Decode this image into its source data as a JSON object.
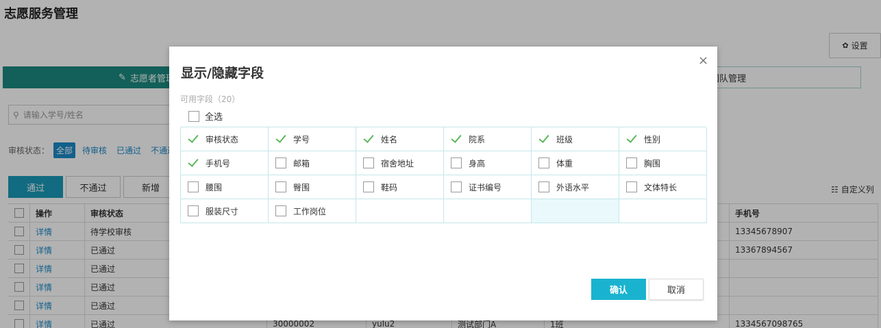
{
  "page": {
    "title": "志愿服务管理",
    "settings_label": "设置",
    "tabs": {
      "active": "志愿者管理",
      "inactive": "团队管理"
    },
    "search_placeholder": "请输入学号/姓名",
    "filter": {
      "label": "审核状态：",
      "options": [
        "全部",
        "待审核",
        "已通过",
        "不通过"
      ]
    },
    "actions": [
      "通过",
      "不通过",
      "新增"
    ],
    "custom_columns_label": "自定义列",
    "table": {
      "headers": {
        "op": "操作",
        "status": "审核状态",
        "phone": "手机号"
      },
      "rows": [
        {
          "op": "详情",
          "status": "待学校审核",
          "no": "",
          "name": "",
          "dept": "",
          "class": "",
          "phone": "13345678907"
        },
        {
          "op": "详情",
          "status": "已通过",
          "no": "",
          "name": "",
          "dept": "",
          "class": "",
          "phone": "13367894567"
        },
        {
          "op": "详情",
          "status": "已通过",
          "no": "",
          "name": "",
          "dept": "",
          "class": "",
          "phone": ""
        },
        {
          "op": "详情",
          "status": "已通过",
          "no": "",
          "name": "",
          "dept": "",
          "class": "",
          "phone": ""
        },
        {
          "op": "详情",
          "status": "已通过",
          "no": "",
          "name": "",
          "dept": "",
          "class": "",
          "phone": ""
        },
        {
          "op": "详情",
          "status": "已通过",
          "no": "30000002",
          "name": "yulu2",
          "dept": "测试部门A",
          "class": "1班",
          "phone": "1334567098765"
        }
      ]
    }
  },
  "modal": {
    "title": "显示/隐藏字段",
    "available_label": "可用字段（20）",
    "select_all_label": "全选",
    "fields": [
      {
        "label": "审核状态",
        "checked": true
      },
      {
        "label": "学号",
        "checked": true
      },
      {
        "label": "姓名",
        "checked": true
      },
      {
        "label": "院系",
        "checked": true
      },
      {
        "label": "班级",
        "checked": true
      },
      {
        "label": "性别",
        "checked": true
      },
      {
        "label": "手机号",
        "checked": true
      },
      {
        "label": "邮箱",
        "checked": false
      },
      {
        "label": "宿舍地址",
        "checked": false
      },
      {
        "label": "身高",
        "checked": false
      },
      {
        "label": "体重",
        "checked": false
      },
      {
        "label": "胸围",
        "checked": false
      },
      {
        "label": "腰围",
        "checked": false
      },
      {
        "label": "臀围",
        "checked": false
      },
      {
        "label": "鞋码",
        "checked": false
      },
      {
        "label": "证书编号",
        "checked": false
      },
      {
        "label": "外语水平",
        "checked": false
      },
      {
        "label": "文体特长",
        "checked": false
      },
      {
        "label": "服装尺寸",
        "checked": false
      },
      {
        "label": "工作岗位",
        "checked": false
      }
    ],
    "confirm_label": "确认",
    "cancel_label": "取消",
    "close_glyph": "×"
  },
  "colors": {
    "primary": "#1a9ab8",
    "tab_active": "#1a8a80",
    "check_green": "#5cb85c",
    "confirm": "#1ab3cf"
  }
}
